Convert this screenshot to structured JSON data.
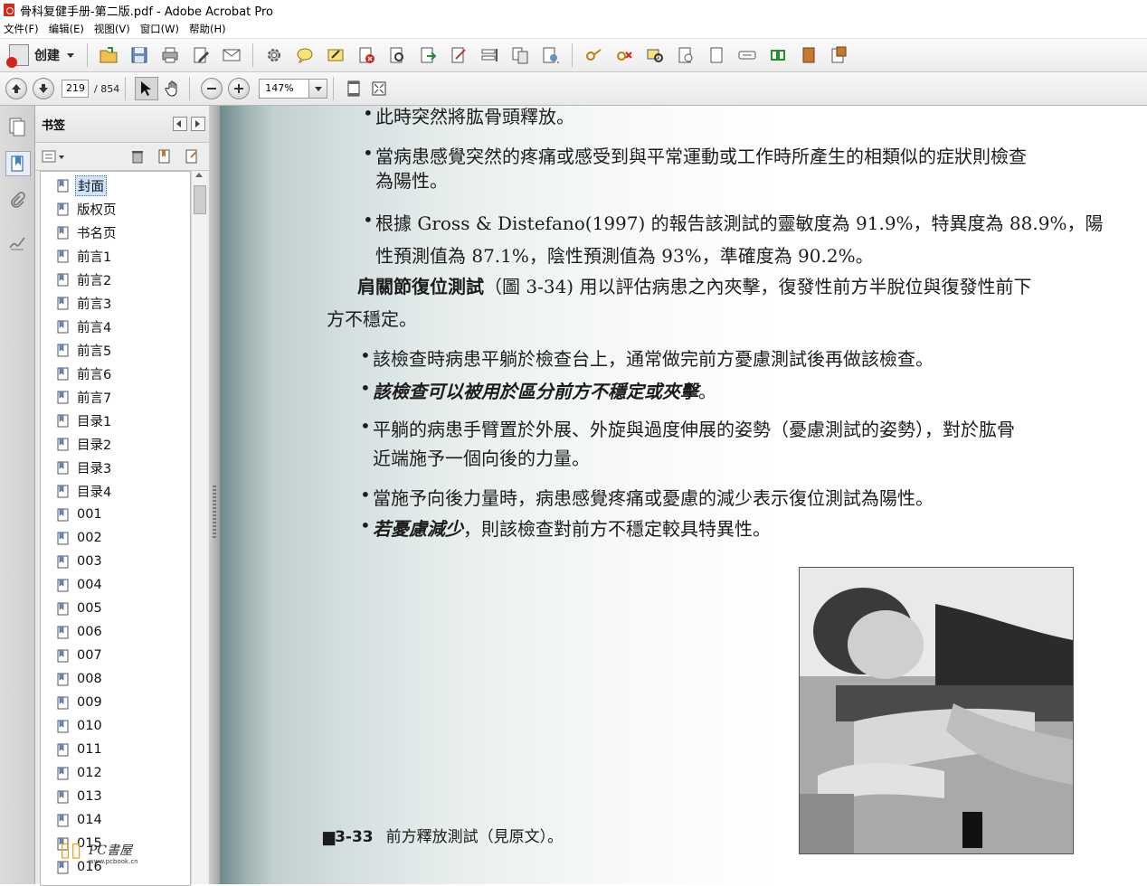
{
  "window": {
    "title": "骨科复健手册-第二版.pdf - Adobe Acrobat Pro"
  },
  "menu": [
    "文件(F)",
    "编辑(E)",
    "视图(V)",
    "窗口(W)",
    "帮助(H)"
  ],
  "toolbar": {
    "create_label": "创建"
  },
  "nav": {
    "current_page": "219",
    "total_pages": "/ 854",
    "zoom": "147%"
  },
  "panel": {
    "title": "书签",
    "bookmarks": [
      "封面",
      "版权页",
      "书名页",
      "前言1",
      "前言2",
      "前言3",
      "前言4",
      "前言5",
      "前言6",
      "前言7",
      "目录1",
      "目录2",
      "目录3",
      "目录4",
      "001",
      "002",
      "003",
      "004",
      "005",
      "006",
      "007",
      "008",
      "009",
      "010",
      "011",
      "012",
      "013",
      "014",
      "015",
      "016"
    ],
    "selected_index": 0
  },
  "document": {
    "lines": [
      "此時突然將肱骨頭釋放。",
      "當病患感覺突然的疼痛或感受到與平常運動或工作時所產生的相類似的症狀則檢查",
      "為陽性。",
      "根據 Gross & Distefano(1997) 的報告該測試的靈敏度為 91.9%，特異度為 88.9%，陽",
      "性預測值為 87.1%，陰性預測值為 93%，準確度為 90.2%。",
      "肩關節復位測試",
      "（圖 3-34) 用以評估病患之內夾擊，復發性前方半脫位與復發性前下",
      "方不穩定。",
      "該檢查時病患平躺於檢查台上，通常做完前方憂慮測試後再做該檢查。",
      "該檢查可以被用於區分前方不穩定或夾擊",
      "。",
      "平躺的病患手臂置於外展、外旋與過度伸展的姿勢（憂慮測試的姿勢），對於肱骨",
      "近端施予一個向後的力量。",
      "當施予向後力量時，病患感覺疼痛或憂慮的減少表示復位測試為陽性。",
      "若憂慮減少",
      "，則該檢查對前方不穩定較具特異性。"
    ],
    "caption_num": "3-33",
    "caption_text": "前方釋放測試（見原文）。"
  },
  "watermark": {
    "text": "PC書屋",
    "subtext": "www.pcbook.cn"
  }
}
